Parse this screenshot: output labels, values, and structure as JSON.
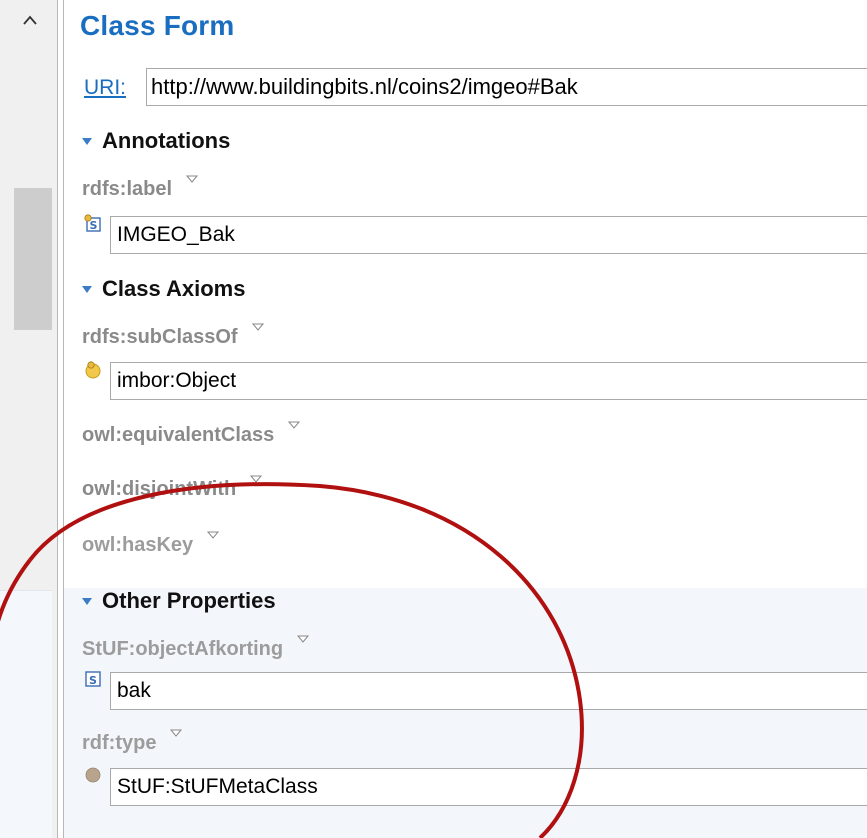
{
  "form": {
    "title": "Class Form",
    "uri_label": "URI:",
    "uri_value": "http://www.buildingbits.nl/coins2/imgeo#Bak"
  },
  "sections": {
    "annotations": "Annotations",
    "class_axioms": "Class Axioms",
    "other_properties": "Other Properties"
  },
  "properties": {
    "label": {
      "name": "rdfs:label",
      "value": "IMGEO_Bak",
      "icon": "string-literal-icon"
    },
    "subclassof": {
      "name": "rdfs:subClassOf",
      "value": "imbor:Object",
      "icon": "class-resource-icon"
    },
    "equivalentclass": {
      "name": "owl:equivalentClass"
    },
    "disjointwith": {
      "name": "owl:disjointWith"
    },
    "haskey": {
      "name": "owl:hasKey"
    },
    "objectafkorting": {
      "name": "StUF:objectAfkorting",
      "value": "bak",
      "icon": "string-literal-icon"
    },
    "type": {
      "name": "rdf:type",
      "value": "StUF:StUFMetaClass",
      "icon": "instance-resource-icon"
    }
  },
  "colors": {
    "title": "#1a6ec0",
    "annotation_circle": "#b01010",
    "section_triangle": "#3a7dc4"
  }
}
